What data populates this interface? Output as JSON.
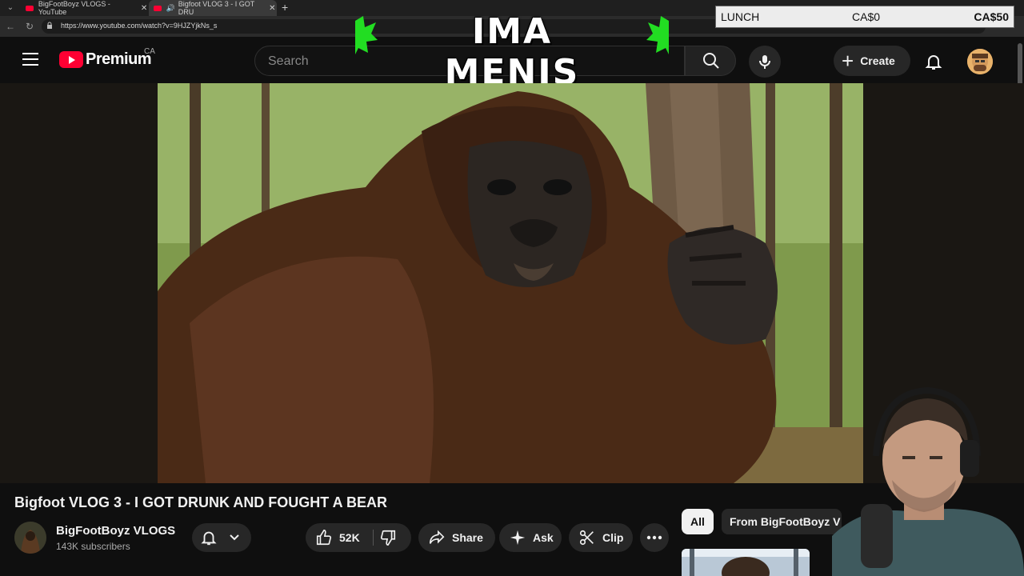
{
  "browser": {
    "tabs": [
      {
        "title": "BigFootBoyz VLOGS - YouTube"
      },
      {
        "title": "Bigfoot VLOG 3 - I GOT DRU"
      }
    ],
    "url": "https://www.youtube.com/watch?v=9HJZYjkNs_s"
  },
  "overlay": {
    "title": "IMA MENIS"
  },
  "lunch_goal": {
    "label": "LUNCH",
    "current": "CA$0",
    "goal": "CA$50"
  },
  "header": {
    "logo_text": "Premium",
    "region": "CA",
    "search_placeholder": "Search",
    "create_label": "Create"
  },
  "video": {
    "title": "Bigfoot VLOG 3 - I GOT DRUNK AND FOUGHT A BEAR"
  },
  "channel": {
    "name": "BigFootBoyz VLOGS",
    "subscribers": "143K subscribers"
  },
  "actions": {
    "likes": "52K",
    "share": "Share",
    "ask": "Ask",
    "clip": "Clip"
  },
  "chips": {
    "all": "All",
    "from": "From BigFootBoyz V"
  },
  "colors": {
    "brand": "#ff0033",
    "background": "#0f0f0f",
    "overlay_accent": "#22dd22"
  }
}
